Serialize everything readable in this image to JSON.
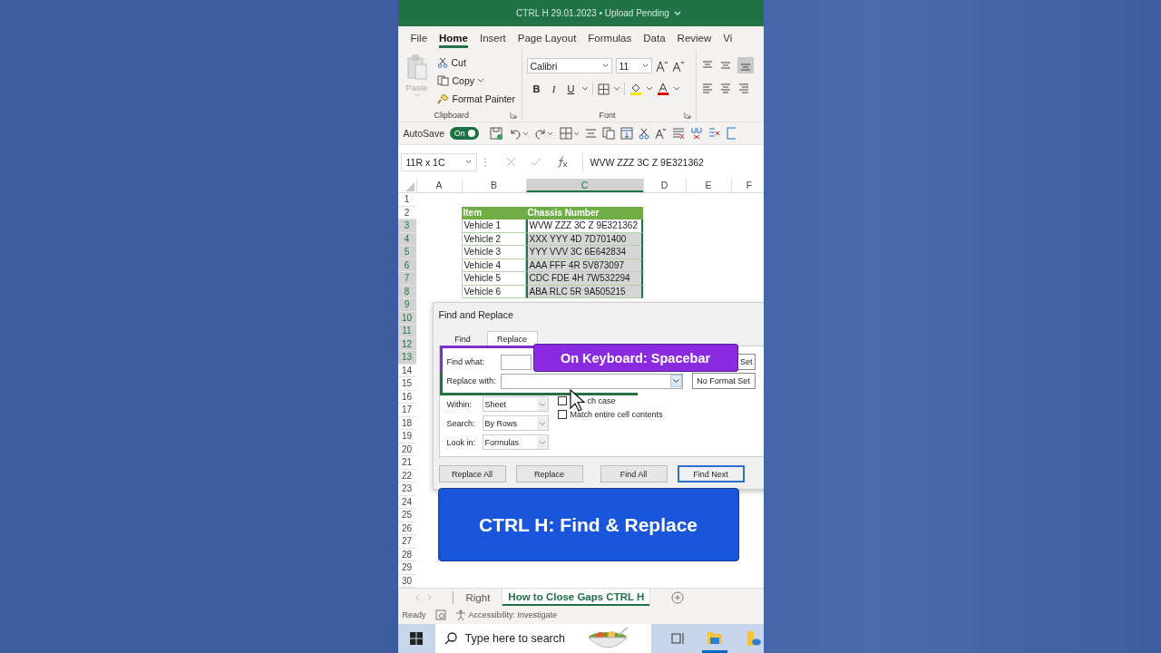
{
  "title_bar": {
    "title": "CTRL H 29.01.2023 • Upload Pending"
  },
  "ribbon_tabs": [
    {
      "label": "File",
      "selected": false
    },
    {
      "label": "Home",
      "selected": true
    },
    {
      "label": "Insert",
      "selected": false
    },
    {
      "label": "Page Layout",
      "selected": false
    },
    {
      "label": "Formulas",
      "selected": false
    },
    {
      "label": "Data",
      "selected": false
    },
    {
      "label": "Review",
      "selected": false
    },
    {
      "label": "Vi",
      "selected": false
    }
  ],
  "clipboard": {
    "paste": "Paste",
    "cut": "Cut",
    "copy": "Copy",
    "format_painter": "Format Painter",
    "group_label": "Clipboard"
  },
  "font": {
    "name": "Calibri",
    "size": "11",
    "bold": "B",
    "italic": "I",
    "underline": "U",
    "group_label": "Font"
  },
  "quick_access": {
    "autosave_label": "AutoSave",
    "autosave_state": "On",
    "autosave_on": true
  },
  "formula_bar": {
    "name_box": "11R x 1C",
    "formula": "WVW ZZZ 3C Z 9E321362"
  },
  "sheet": {
    "columns": [
      {
        "label": "A",
        "selected": false
      },
      {
        "label": "B",
        "selected": false
      },
      {
        "label": "C",
        "selected": true
      },
      {
        "label": "D",
        "selected": false
      },
      {
        "label": "E",
        "selected": false
      },
      {
        "label": "F",
        "selected": false
      }
    ],
    "rows": [
      {
        "number": "1",
        "selected": false,
        "kind": "empty"
      },
      {
        "number": "2",
        "selected": false,
        "kind": "header",
        "cells": [
          "Item",
          "Chassis Number"
        ]
      },
      {
        "number": "3",
        "selected": true,
        "kind": "data",
        "active": true,
        "cells": [
          "Vehicle 1",
          "WVW ZZZ 3C Z 9E321362"
        ]
      },
      {
        "number": "4",
        "selected": true,
        "kind": "data",
        "active": false,
        "cells": [
          "Vehicle 2",
          "XXX YYY 4D 7D701400"
        ]
      },
      {
        "number": "5",
        "selected": true,
        "kind": "data",
        "active": false,
        "cells": [
          "Vehicle 3",
          "YYY VVV 3C 6E642834"
        ]
      },
      {
        "number": "6",
        "selected": true,
        "kind": "data",
        "active": false,
        "cells": [
          "Vehicle 4",
          "AAA FFF 4R 5V873097"
        ]
      },
      {
        "number": "7",
        "selected": true,
        "kind": "data",
        "active": false,
        "cells": [
          "Vehicle 5",
          "CDC FDE 4H 7W532294"
        ]
      },
      {
        "number": "8",
        "selected": true,
        "kind": "data",
        "active": false,
        "cells": [
          "Vehicle 6",
          "ABA RLC 5R 9A505215"
        ]
      },
      {
        "number": "9",
        "selected": true,
        "kind": "empty"
      },
      {
        "number": "10",
        "selected": true,
        "kind": "empty"
      },
      {
        "number": "11",
        "selected": true,
        "kind": "empty"
      },
      {
        "number": "12",
        "selected": true,
        "kind": "empty"
      },
      {
        "number": "13",
        "selected": true,
        "kind": "empty"
      },
      {
        "number": "14",
        "selected": false,
        "kind": "empty"
      },
      {
        "number": "15",
        "selected": false,
        "kind": "empty"
      },
      {
        "number": "16",
        "selected": false,
        "kind": "empty"
      },
      {
        "number": "17",
        "selected": false,
        "kind": "empty"
      },
      {
        "number": "18",
        "selected": false,
        "kind": "empty"
      },
      {
        "number": "19",
        "selected": false,
        "kind": "empty"
      },
      {
        "number": "20",
        "selected": false,
        "kind": "empty"
      },
      {
        "number": "21",
        "selected": false,
        "kind": "empty"
      },
      {
        "number": "22",
        "selected": false,
        "kind": "empty"
      },
      {
        "number": "23",
        "selected": false,
        "kind": "empty"
      },
      {
        "number": "24",
        "selected": false,
        "kind": "empty"
      },
      {
        "number": "25",
        "selected": false,
        "kind": "empty"
      },
      {
        "number": "26",
        "selected": false,
        "kind": "empty"
      },
      {
        "number": "27",
        "selected": false,
        "kind": "empty"
      },
      {
        "number": "28",
        "selected": false,
        "kind": "empty"
      },
      {
        "number": "29",
        "selected": false,
        "kind": "empty"
      },
      {
        "number": "30",
        "selected": false,
        "kind": "empty"
      }
    ]
  },
  "dialog": {
    "title": "Find and Replace",
    "tabs": [
      {
        "label": "Find",
        "selected": false
      },
      {
        "label": "Replace",
        "selected": true
      }
    ],
    "find_label": "Find what:",
    "find_format_button": "Set",
    "replace_label": "Replace with:",
    "replace_format_button": "No Format Set",
    "options": [
      {
        "label": "Within:",
        "value": "Sheet"
      },
      {
        "label": "Search:",
        "value": "By Rows"
      },
      {
        "label": "Look in:",
        "value": "Formulas"
      }
    ],
    "checkboxes": [
      {
        "label": "ch case",
        "checked": false
      },
      {
        "label": "Match entire cell contents",
        "checked": false
      }
    ],
    "buttons": [
      {
        "label": "Replace All",
        "default": false
      },
      {
        "label": "Replace",
        "default": false
      },
      {
        "label": "Find All",
        "default": false
      },
      {
        "label": "Find Next",
        "default": true
      }
    ]
  },
  "overlays": {
    "keyboard_caption": "On Keyboard: Spacebar",
    "main_caption": "CTRL H: Find & Replace"
  },
  "sheet_tabs": [
    {
      "label": "Right",
      "selected": false
    },
    {
      "label": "How to Close Gaps CTRL H",
      "selected": true
    }
  ],
  "status_bar": {
    "ready": "Ready",
    "accessibility": "Accessibility: Investigate"
  },
  "taskbar": {
    "search_placeholder": "Type here to search"
  }
}
